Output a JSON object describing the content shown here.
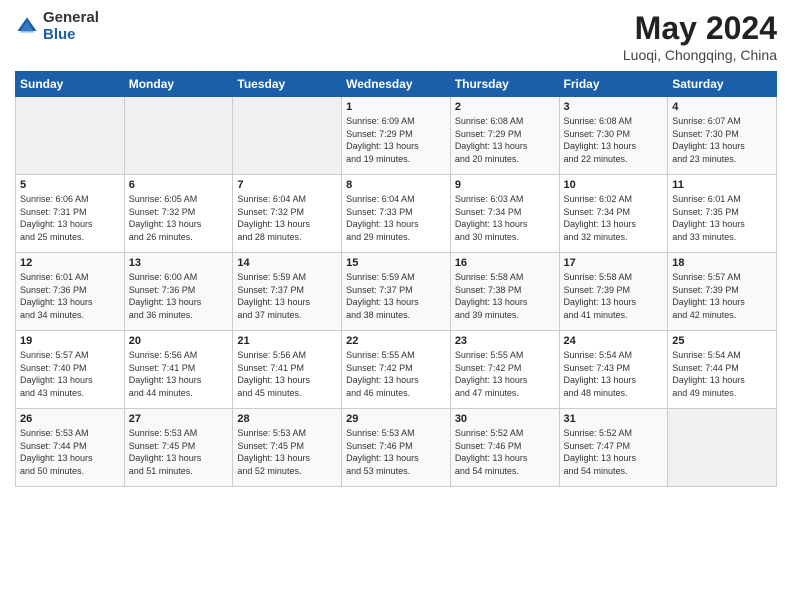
{
  "header": {
    "logo_general": "General",
    "logo_blue": "Blue",
    "title": "May 2024",
    "location": "Luoqi, Chongqing, China"
  },
  "days_of_week": [
    "Sunday",
    "Monday",
    "Tuesday",
    "Wednesday",
    "Thursday",
    "Friday",
    "Saturday"
  ],
  "weeks": [
    [
      {
        "day": "",
        "info": ""
      },
      {
        "day": "",
        "info": ""
      },
      {
        "day": "",
        "info": ""
      },
      {
        "day": "1",
        "info": "Sunrise: 6:09 AM\nSunset: 7:29 PM\nDaylight: 13 hours\nand 19 minutes."
      },
      {
        "day": "2",
        "info": "Sunrise: 6:08 AM\nSunset: 7:29 PM\nDaylight: 13 hours\nand 20 minutes."
      },
      {
        "day": "3",
        "info": "Sunrise: 6:08 AM\nSunset: 7:30 PM\nDaylight: 13 hours\nand 22 minutes."
      },
      {
        "day": "4",
        "info": "Sunrise: 6:07 AM\nSunset: 7:30 PM\nDaylight: 13 hours\nand 23 minutes."
      }
    ],
    [
      {
        "day": "5",
        "info": "Sunrise: 6:06 AM\nSunset: 7:31 PM\nDaylight: 13 hours\nand 25 minutes."
      },
      {
        "day": "6",
        "info": "Sunrise: 6:05 AM\nSunset: 7:32 PM\nDaylight: 13 hours\nand 26 minutes."
      },
      {
        "day": "7",
        "info": "Sunrise: 6:04 AM\nSunset: 7:32 PM\nDaylight: 13 hours\nand 28 minutes."
      },
      {
        "day": "8",
        "info": "Sunrise: 6:04 AM\nSunset: 7:33 PM\nDaylight: 13 hours\nand 29 minutes."
      },
      {
        "day": "9",
        "info": "Sunrise: 6:03 AM\nSunset: 7:34 PM\nDaylight: 13 hours\nand 30 minutes."
      },
      {
        "day": "10",
        "info": "Sunrise: 6:02 AM\nSunset: 7:34 PM\nDaylight: 13 hours\nand 32 minutes."
      },
      {
        "day": "11",
        "info": "Sunrise: 6:01 AM\nSunset: 7:35 PM\nDaylight: 13 hours\nand 33 minutes."
      }
    ],
    [
      {
        "day": "12",
        "info": "Sunrise: 6:01 AM\nSunset: 7:36 PM\nDaylight: 13 hours\nand 34 minutes."
      },
      {
        "day": "13",
        "info": "Sunrise: 6:00 AM\nSunset: 7:36 PM\nDaylight: 13 hours\nand 36 minutes."
      },
      {
        "day": "14",
        "info": "Sunrise: 5:59 AM\nSunset: 7:37 PM\nDaylight: 13 hours\nand 37 minutes."
      },
      {
        "day": "15",
        "info": "Sunrise: 5:59 AM\nSunset: 7:37 PM\nDaylight: 13 hours\nand 38 minutes."
      },
      {
        "day": "16",
        "info": "Sunrise: 5:58 AM\nSunset: 7:38 PM\nDaylight: 13 hours\nand 39 minutes."
      },
      {
        "day": "17",
        "info": "Sunrise: 5:58 AM\nSunset: 7:39 PM\nDaylight: 13 hours\nand 41 minutes."
      },
      {
        "day": "18",
        "info": "Sunrise: 5:57 AM\nSunset: 7:39 PM\nDaylight: 13 hours\nand 42 minutes."
      }
    ],
    [
      {
        "day": "19",
        "info": "Sunrise: 5:57 AM\nSunset: 7:40 PM\nDaylight: 13 hours\nand 43 minutes."
      },
      {
        "day": "20",
        "info": "Sunrise: 5:56 AM\nSunset: 7:41 PM\nDaylight: 13 hours\nand 44 minutes."
      },
      {
        "day": "21",
        "info": "Sunrise: 5:56 AM\nSunset: 7:41 PM\nDaylight: 13 hours\nand 45 minutes."
      },
      {
        "day": "22",
        "info": "Sunrise: 5:55 AM\nSunset: 7:42 PM\nDaylight: 13 hours\nand 46 minutes."
      },
      {
        "day": "23",
        "info": "Sunrise: 5:55 AM\nSunset: 7:42 PM\nDaylight: 13 hours\nand 47 minutes."
      },
      {
        "day": "24",
        "info": "Sunrise: 5:54 AM\nSunset: 7:43 PM\nDaylight: 13 hours\nand 48 minutes."
      },
      {
        "day": "25",
        "info": "Sunrise: 5:54 AM\nSunset: 7:44 PM\nDaylight: 13 hours\nand 49 minutes."
      }
    ],
    [
      {
        "day": "26",
        "info": "Sunrise: 5:53 AM\nSunset: 7:44 PM\nDaylight: 13 hours\nand 50 minutes."
      },
      {
        "day": "27",
        "info": "Sunrise: 5:53 AM\nSunset: 7:45 PM\nDaylight: 13 hours\nand 51 minutes."
      },
      {
        "day": "28",
        "info": "Sunrise: 5:53 AM\nSunset: 7:45 PM\nDaylight: 13 hours\nand 52 minutes."
      },
      {
        "day": "29",
        "info": "Sunrise: 5:53 AM\nSunset: 7:46 PM\nDaylight: 13 hours\nand 53 minutes."
      },
      {
        "day": "30",
        "info": "Sunrise: 5:52 AM\nSunset: 7:46 PM\nDaylight: 13 hours\nand 54 minutes."
      },
      {
        "day": "31",
        "info": "Sunrise: 5:52 AM\nSunset: 7:47 PM\nDaylight: 13 hours\nand 54 minutes."
      },
      {
        "day": "",
        "info": ""
      }
    ]
  ]
}
